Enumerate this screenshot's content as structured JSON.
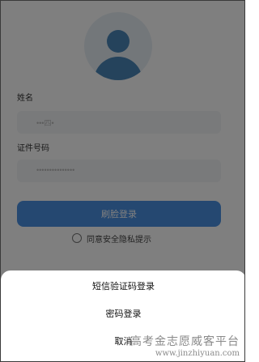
{
  "form": {
    "name_label": "姓名",
    "name_value": "•••四•",
    "id_label": "证件号码",
    "id_value": "•••••••••••••••",
    "submit_label": "刷脸登录",
    "consent_text": "同意安全隐私提示"
  },
  "sheet": {
    "items": [
      {
        "label": "短信验证码登录"
      },
      {
        "label": "密码登录"
      },
      {
        "label": "取消"
      }
    ]
  },
  "watermark": {
    "title": "高考金志愿威客平台",
    "url": "www.jinzhiyuan.com"
  },
  "colors": {
    "primary": "#4a90e2",
    "avatar": "#4b87b8",
    "overlay": "rgba(0,0,0,0.5)"
  }
}
